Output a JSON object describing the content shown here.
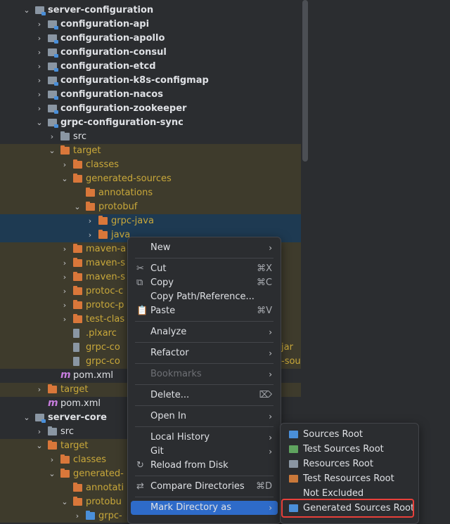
{
  "tree": [
    {
      "label": "server-configuration",
      "depth": 2,
      "icon": "module",
      "expanded": true,
      "style": "bold"
    },
    {
      "label": "configuration-api",
      "depth": 3,
      "icon": "module",
      "expanded": false,
      "style": "bold"
    },
    {
      "label": "configuration-apollo",
      "depth": 3,
      "icon": "module",
      "expanded": false,
      "style": "bold"
    },
    {
      "label": "configuration-consul",
      "depth": 3,
      "icon": "module",
      "expanded": false,
      "style": "bold"
    },
    {
      "label": "configuration-etcd",
      "depth": 3,
      "icon": "module",
      "expanded": false,
      "style": "bold"
    },
    {
      "label": "configuration-k8s-configmap",
      "depth": 3,
      "icon": "module",
      "expanded": false,
      "style": "bold"
    },
    {
      "label": "configuration-nacos",
      "depth": 3,
      "icon": "module",
      "expanded": false,
      "style": "bold"
    },
    {
      "label": "configuration-zookeeper",
      "depth": 3,
      "icon": "module",
      "expanded": false,
      "style": "bold"
    },
    {
      "label": "grpc-configuration-sync",
      "depth": 3,
      "icon": "module",
      "expanded": true,
      "style": "bold"
    },
    {
      "label": "src",
      "depth": 4,
      "icon": "folder",
      "expanded": false,
      "style": "normal"
    },
    {
      "label": "target",
      "depth": 4,
      "icon": "folder-orange",
      "expanded": true,
      "style": "excluded"
    },
    {
      "label": "classes",
      "depth": 5,
      "icon": "folder-orange",
      "expanded": false,
      "style": "excluded"
    },
    {
      "label": "generated-sources",
      "depth": 5,
      "icon": "folder-orange",
      "expanded": true,
      "style": "excluded"
    },
    {
      "label": "annotations",
      "depth": 6,
      "icon": "folder-orange",
      "expanded": null,
      "style": "excluded"
    },
    {
      "label": "protobuf",
      "depth": 6,
      "icon": "folder-orange",
      "expanded": true,
      "style": "excluded"
    },
    {
      "label": "grpc-java",
      "depth": 7,
      "icon": "folder-orange",
      "expanded": false,
      "style": "selected"
    },
    {
      "label": "java",
      "depth": 7,
      "icon": "folder-orange",
      "expanded": false,
      "style": "selected"
    },
    {
      "label": "maven-a",
      "depth": 5,
      "icon": "folder-orange",
      "expanded": false,
      "style": "excluded"
    },
    {
      "label": "maven-s",
      "depth": 5,
      "icon": "folder-orange",
      "expanded": false,
      "style": "excluded"
    },
    {
      "label": "maven-s",
      "depth": 5,
      "icon": "folder-orange",
      "expanded": false,
      "style": "excluded"
    },
    {
      "label": "protoc-c",
      "depth": 5,
      "icon": "folder-orange",
      "expanded": false,
      "style": "excluded"
    },
    {
      "label": "protoc-p",
      "depth": 5,
      "icon": "folder-orange",
      "expanded": false,
      "style": "excluded"
    },
    {
      "label": "test-clas",
      "depth": 5,
      "icon": "folder-orange",
      "expanded": false,
      "style": "excluded"
    },
    {
      "label": ".plxarc",
      "depth": 5,
      "icon": "file",
      "expanded": null,
      "style": "excluded"
    },
    {
      "label": "grpc-co",
      "depth": 5,
      "icon": "file",
      "expanded": null,
      "style": "excluded",
      "suffix": "jar"
    },
    {
      "label": "grpc-co",
      "depth": 5,
      "icon": "file",
      "expanded": null,
      "style": "excluded",
      "suffix": "-sour"
    },
    {
      "label": "pom.xml",
      "depth": 4,
      "icon": "maven",
      "expanded": null,
      "style": "normal"
    },
    {
      "label": "target",
      "depth": 3,
      "icon": "folder-orange",
      "expanded": false,
      "style": "excluded"
    },
    {
      "label": "pom.xml",
      "depth": 3,
      "icon": "maven",
      "expanded": null,
      "style": "normal"
    },
    {
      "label": "server-core",
      "depth": 2,
      "icon": "module",
      "expanded": true,
      "style": "bold"
    },
    {
      "label": "src",
      "depth": 3,
      "icon": "folder",
      "expanded": false,
      "style": "normal"
    },
    {
      "label": "target",
      "depth": 3,
      "icon": "folder-orange",
      "expanded": true,
      "style": "excluded"
    },
    {
      "label": "classes",
      "depth": 4,
      "icon": "folder-orange",
      "expanded": false,
      "style": "excluded"
    },
    {
      "label": "generated-",
      "depth": 4,
      "icon": "folder-orange",
      "expanded": true,
      "style": "excluded"
    },
    {
      "label": "annotati",
      "depth": 5,
      "icon": "folder-orange",
      "expanded": null,
      "style": "excluded"
    },
    {
      "label": "protobu",
      "depth": 5,
      "icon": "folder-orange",
      "expanded": true,
      "style": "excluded"
    },
    {
      "label": "grpc-",
      "depth": 6,
      "icon": "folder-blue",
      "expanded": false,
      "style": "excluded"
    }
  ],
  "menu": [
    {
      "label": "New",
      "shortcut": "",
      "submenu": true,
      "icon": "",
      "disabled": false,
      "sepBefore": false
    },
    {
      "label": "Cut",
      "shortcut": "⌘X",
      "submenu": false,
      "icon": "✂",
      "disabled": false,
      "sepBefore": true
    },
    {
      "label": "Copy",
      "shortcut": "⌘C",
      "submenu": false,
      "icon": "⧉",
      "disabled": false,
      "sepBefore": false
    },
    {
      "label": "Copy Path/Reference...",
      "shortcut": "",
      "submenu": false,
      "icon": "",
      "disabled": false,
      "sepBefore": false
    },
    {
      "label": "Paste",
      "shortcut": "⌘V",
      "submenu": false,
      "icon": "📋",
      "disabled": false,
      "sepBefore": false
    },
    {
      "label": "Analyze",
      "shortcut": "",
      "submenu": true,
      "icon": "",
      "disabled": false,
      "sepBefore": true
    },
    {
      "label": "Refactor",
      "shortcut": "",
      "submenu": true,
      "icon": "",
      "disabled": false,
      "sepBefore": true
    },
    {
      "label": "Bookmarks",
      "shortcut": "",
      "submenu": true,
      "icon": "",
      "disabled": true,
      "sepBefore": true
    },
    {
      "label": "Delete...",
      "shortcut": "⌦",
      "submenu": false,
      "icon": "",
      "disabled": false,
      "sepBefore": true
    },
    {
      "label": "Open In",
      "shortcut": "",
      "submenu": true,
      "icon": "",
      "disabled": false,
      "sepBefore": true
    },
    {
      "label": "Local History",
      "shortcut": "",
      "submenu": true,
      "icon": "",
      "disabled": false,
      "sepBefore": true
    },
    {
      "label": "Git",
      "shortcut": "",
      "submenu": true,
      "icon": "",
      "disabled": false,
      "sepBefore": false
    },
    {
      "label": "Reload from Disk",
      "shortcut": "",
      "submenu": false,
      "icon": "↻",
      "disabled": false,
      "sepBefore": false
    },
    {
      "label": "Compare Directories",
      "shortcut": "⌘D",
      "submenu": false,
      "icon": "⇄",
      "disabled": false,
      "sepBefore": true
    },
    {
      "label": "Mark Directory as",
      "shortcut": "",
      "submenu": true,
      "icon": "",
      "disabled": false,
      "sepBefore": true,
      "highlighted": true
    }
  ],
  "submenu": [
    {
      "label": "Sources Root",
      "color": "#4a8fd9"
    },
    {
      "label": "Test Sources Root",
      "color": "#5fa35f"
    },
    {
      "label": "Resources Root",
      "color": "#8a96a3"
    },
    {
      "label": "Test Resources Root",
      "color": "#c9783a"
    },
    {
      "label": "Not Excluded",
      "color": ""
    },
    {
      "label": "Generated Sources Root",
      "color": "#4a8fd9"
    }
  ]
}
